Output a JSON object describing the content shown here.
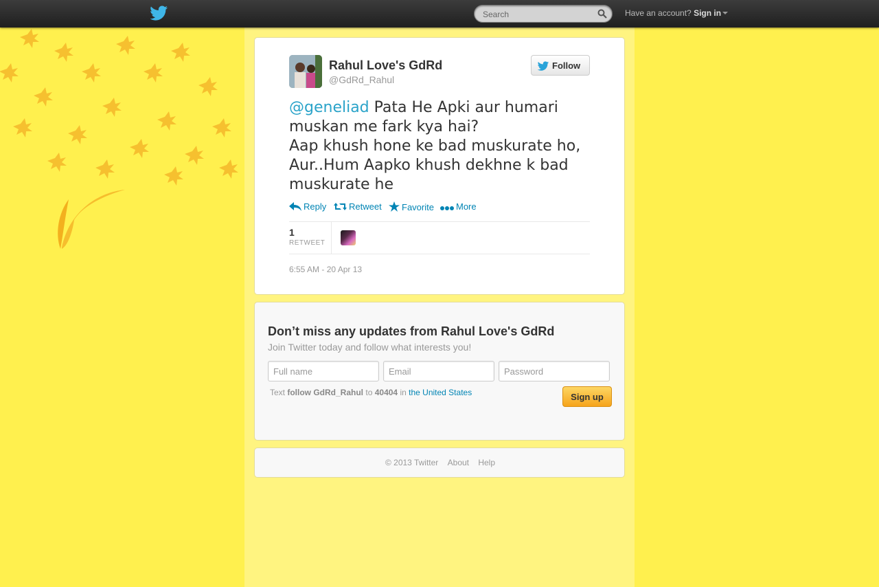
{
  "topbar": {
    "search_placeholder": "Search",
    "account_prompt": "Have an account?",
    "signin_label": "Sign in"
  },
  "tweet": {
    "fullname": "Rahul Love's GdRd",
    "screenname": "@GdRd_Rahul",
    "follow_label": "Follow",
    "mention": "@geneliad",
    "text_line1": " Pata He Apki aur humari muskan me fark kya hai?",
    "text_line2": "Aap khush hone ke bad muskurate ho, Aur..Hum Aapko khush dekhne k bad muskurate he",
    "actions": {
      "reply": "Reply",
      "retweet": "Retweet",
      "favorite": "Favorite",
      "more": "More"
    },
    "retweet_count": "1",
    "retweet_label": "RETWEET",
    "timestamp": "6:55 AM - 20 Apr 13"
  },
  "signup": {
    "title": "Don’t miss any updates from Rahul Love's GdRd",
    "subtitle": "Join Twitter today and follow what interests you!",
    "fullname_placeholder": "Full name",
    "email_placeholder": "Email",
    "password_placeholder": "Password",
    "sms_prefix": "Text",
    "sms_command": "follow GdRd_Rahul",
    "sms_to": "to",
    "sms_number": "40404",
    "sms_in": "in",
    "sms_country": "the United States",
    "button_label": "Sign up"
  },
  "footer": {
    "copyright": "© 2013 Twitter",
    "about": "About",
    "help": "Help"
  },
  "colors": {
    "link": "#0084b4",
    "mention": "#2aa3c9",
    "background": "#fff04e",
    "topbar": "#2b2b2b",
    "signup_button": "#f6a41c"
  }
}
